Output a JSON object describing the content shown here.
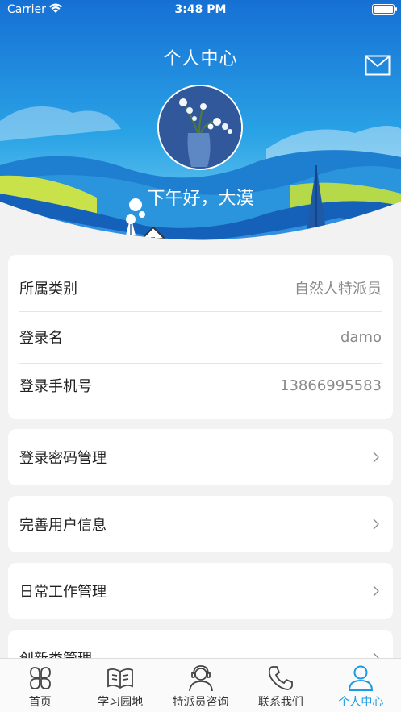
{
  "status": {
    "carrier": "Carrier",
    "time": "3:48 PM"
  },
  "header": {
    "title": "个人中心",
    "greeting": "下午好，大漠"
  },
  "info": [
    {
      "label": "所属类别",
      "value": "自然人特派员"
    },
    {
      "label": "登录名",
      "value": "damo"
    },
    {
      "label": "登录手机号",
      "value": "13866995583"
    }
  ],
  "menu": [
    {
      "label": "登录密码管理"
    },
    {
      "label": "完善用户信息"
    },
    {
      "label": "日常工作管理"
    },
    {
      "label": "创新类管理"
    }
  ],
  "tabs": [
    {
      "label": "首页",
      "icon": "clover-icon"
    },
    {
      "label": "学习园地",
      "icon": "book-icon"
    },
    {
      "label": "特派员咨询",
      "icon": "headset-user-icon"
    },
    {
      "label": "联系我们",
      "icon": "phone-icon"
    },
    {
      "label": "个人中心",
      "icon": "user-icon",
      "active": true
    }
  ],
  "colors": {
    "accent": "#1a9be3",
    "sky_top": "#1673d6",
    "sky_bottom": "#5bc3ee"
  }
}
